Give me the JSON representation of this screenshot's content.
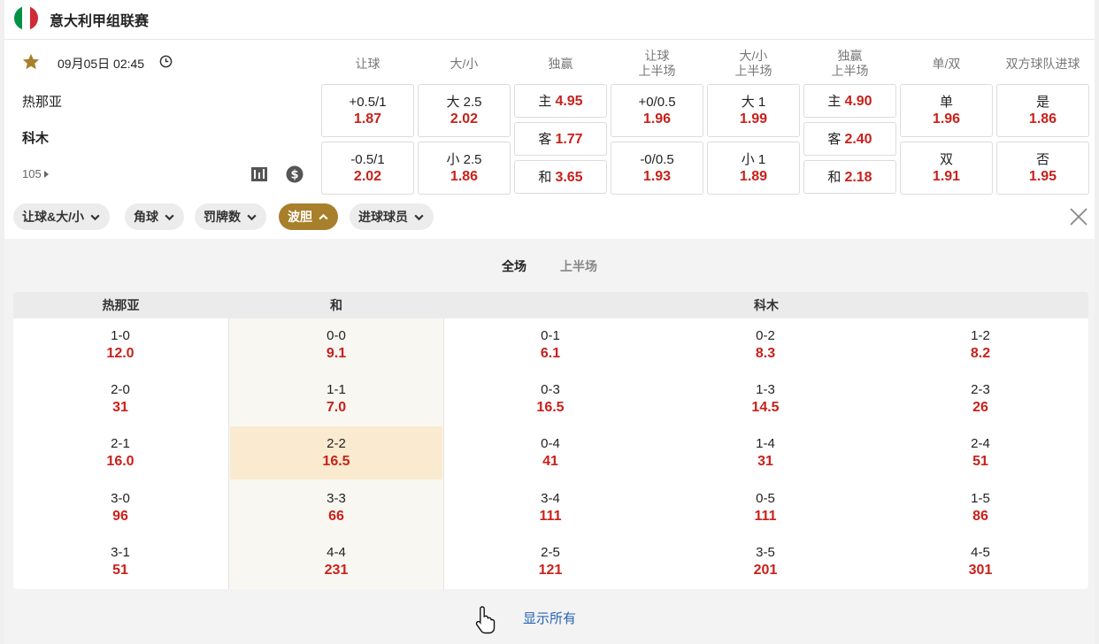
{
  "league": {
    "title": "意大利甲组联赛",
    "flag_colors": [
      "#009246",
      "#ffffff",
      "#ce2b37"
    ]
  },
  "match": {
    "datetime": "09月05日 02:45",
    "home": "热那亚",
    "away": "科木",
    "more_count": "105",
    "icons": [
      "star-icon",
      "clock-icon",
      "stats-icon",
      "dollar-icon"
    ]
  },
  "markets": [
    {
      "h1": "让球",
      "h2": ""
    },
    {
      "h1": "大/小",
      "h2": ""
    },
    {
      "h1": "独赢",
      "h2": ""
    },
    {
      "h1": "让球",
      "h2": "上半场"
    },
    {
      "h1": "大/小",
      "h2": "上半场"
    },
    {
      "h1": "独赢",
      "h2": "上半场"
    },
    {
      "h1": "单/双",
      "h2": ""
    },
    {
      "h1": "双方球队进球",
      "h2": ""
    }
  ],
  "odds": {
    "hdp": [
      {
        "label": "+0.5/1",
        "value": "1.87"
      },
      {
        "label": "-0.5/1",
        "value": "2.02"
      }
    ],
    "ou": [
      {
        "label": "大 2.5",
        "value": "2.02"
      },
      {
        "label": "小 2.5",
        "value": "1.86"
      }
    ],
    "ml": [
      {
        "label": "主",
        "value": "4.95"
      },
      {
        "label": "客",
        "value": "1.77"
      },
      {
        "label": "和",
        "value": "3.65"
      }
    ],
    "hdp_1h": [
      {
        "label": "+0/0.5",
        "value": "1.96"
      },
      {
        "label": "-0/0.5",
        "value": "1.93"
      }
    ],
    "ou_1h": [
      {
        "label": "大 1",
        "value": "1.99"
      },
      {
        "label": "小 1",
        "value": "1.89"
      }
    ],
    "ml_1h": [
      {
        "label": "主",
        "value": "4.90"
      },
      {
        "label": "客",
        "value": "2.40"
      },
      {
        "label": "和",
        "value": "2.18"
      }
    ],
    "oe": [
      {
        "label": "单",
        "value": "1.96"
      },
      {
        "label": "双",
        "value": "1.91"
      }
    ],
    "btts": [
      {
        "label": "是",
        "value": "1.86"
      },
      {
        "label": "否",
        "value": "1.95"
      }
    ]
  },
  "filters": [
    {
      "label": "让球&大/小",
      "active": false
    },
    {
      "label": "角球",
      "active": false
    },
    {
      "label": "罚牌数",
      "active": false
    },
    {
      "label": "波胆",
      "active": true
    },
    {
      "label": "进球球员",
      "active": false
    }
  ],
  "period_tabs": {
    "full": "全场",
    "first_half": "上半场"
  },
  "correct_score": {
    "headers": {
      "home": "热那亚",
      "draw": "和",
      "away": "科木"
    },
    "columns": [
      [
        {
          "s": "1-0",
          "o": "12.0"
        },
        {
          "s": "2-0",
          "o": "31"
        },
        {
          "s": "2-1",
          "o": "16.0"
        },
        {
          "s": "3-0",
          "o": "96"
        },
        {
          "s": "3-1",
          "o": "51"
        }
      ],
      [
        {
          "s": "0-0",
          "o": "9.1"
        },
        {
          "s": "1-1",
          "o": "7.0"
        },
        {
          "s": "2-2",
          "o": "16.5",
          "hl": true
        },
        {
          "s": "3-3",
          "o": "66"
        },
        {
          "s": "4-4",
          "o": "231"
        }
      ],
      [
        {
          "s": "0-1",
          "o": "6.1"
        },
        {
          "s": "0-3",
          "o": "16.5"
        },
        {
          "s": "0-4",
          "o": "41"
        },
        {
          "s": "3-4",
          "o": "111"
        },
        {
          "s": "2-5",
          "o": "121"
        }
      ],
      [
        {
          "s": "0-2",
          "o": "8.3"
        },
        {
          "s": "1-3",
          "o": "14.5"
        },
        {
          "s": "1-4",
          "o": "31"
        },
        {
          "s": "0-5",
          "o": "111"
        },
        {
          "s": "3-5",
          "o": "201"
        }
      ],
      [
        {
          "s": "1-2",
          "o": "8.2"
        },
        {
          "s": "2-3",
          "o": "26"
        },
        {
          "s": "2-4",
          "o": "51"
        },
        {
          "s": "1-5",
          "o": "86"
        },
        {
          "s": "4-5",
          "o": "301"
        }
      ]
    ]
  },
  "show_all": "显示所有",
  "colors": {
    "accent": "#a87f2a",
    "odds": "#c8211b",
    "link": "#2563b4",
    "highlight": "#faebd0"
  }
}
